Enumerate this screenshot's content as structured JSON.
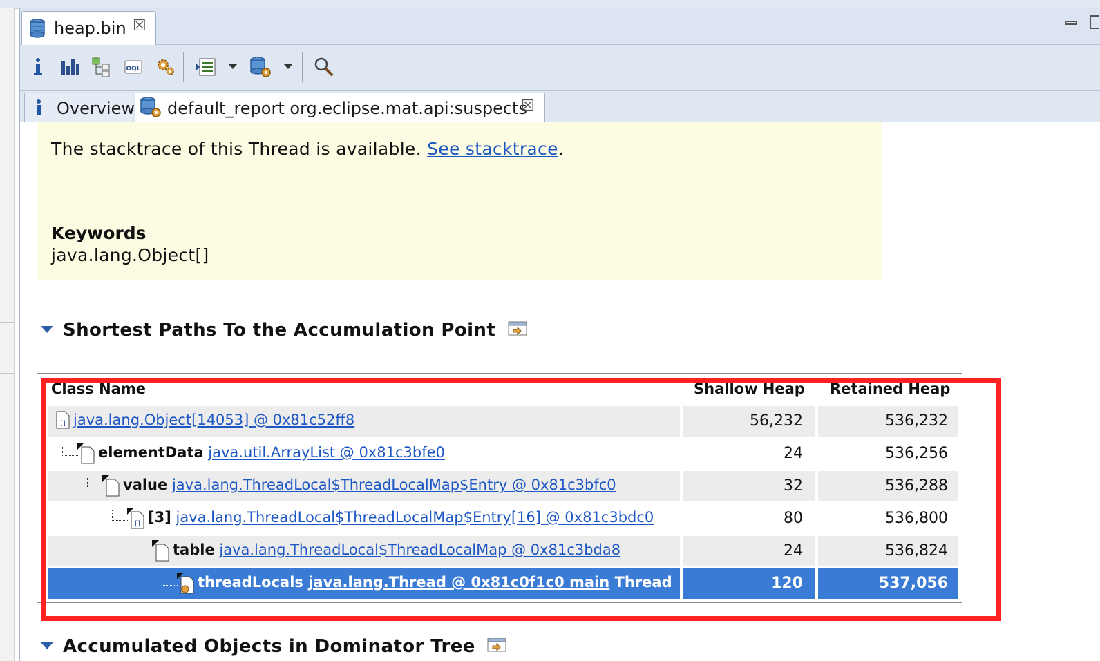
{
  "editor": {
    "tab_label": "heap.bin"
  },
  "toolbar": {
    "icons": [
      "info-icon",
      "histogram-icon",
      "dominator-tree-icon",
      "oql-icon",
      "heap-dump-overview-icon",
      "query-browser-icon",
      "reports-icon",
      "search-icon"
    ]
  },
  "report_tabs": {
    "overview_label": "Overview",
    "report_label": "default_report  org.eclipse.mat.api:suspects"
  },
  "details": {
    "stacktrace_text": "The stacktrace of this Thread is available. ",
    "stacktrace_link": "See stacktrace",
    "stacktrace_period": ".",
    "keywords_title": "Keywords",
    "keywords_value": "java.lang.Object[]"
  },
  "sections": {
    "shortest_paths_title": "Shortest Paths To the Accumulation Point",
    "accumulated_title": "Accumulated Objects in Dominator Tree"
  },
  "table": {
    "headers": {
      "class_name": "Class Name",
      "shallow_heap": "Shallow Heap",
      "retained_heap": "Retained Heap"
    },
    "rows": [
      {
        "field": "",
        "object": "java.lang.Object[14053] @ 0x81c52ff8",
        "suffix": "",
        "shallow": "56,232",
        "retained": "536,232"
      },
      {
        "field": "elementData",
        "object": "java.util.ArrayList @ 0x81c3bfe0",
        "suffix": "",
        "shallow": "24",
        "retained": "536,256"
      },
      {
        "field": "value",
        "object": "java.lang.ThreadLocal$ThreadLocalMap$Entry @ 0x81c3bfc0",
        "suffix": "",
        "shallow": "32",
        "retained": "536,288"
      },
      {
        "field": "[3]",
        "object": "java.lang.ThreadLocal$ThreadLocalMap$Entry[16] @ 0x81c3bdc0",
        "suffix": "",
        "shallow": "80",
        "retained": "536,800"
      },
      {
        "field": "table",
        "object": "java.lang.ThreadLocal$ThreadLocalMap @ 0x81c3bda8",
        "suffix": "",
        "shallow": "24",
        "retained": "536,824"
      },
      {
        "field": "threadLocals",
        "object": "java.lang.Thread @ 0x81c0f1c0 main",
        "suffix": " Thread",
        "shallow": "120",
        "retained": "537,056"
      }
    ]
  },
  "colors": {
    "highlight_box": "#ff2222",
    "selection": "#3a7bd5",
    "link": "#1d57c4"
  }
}
